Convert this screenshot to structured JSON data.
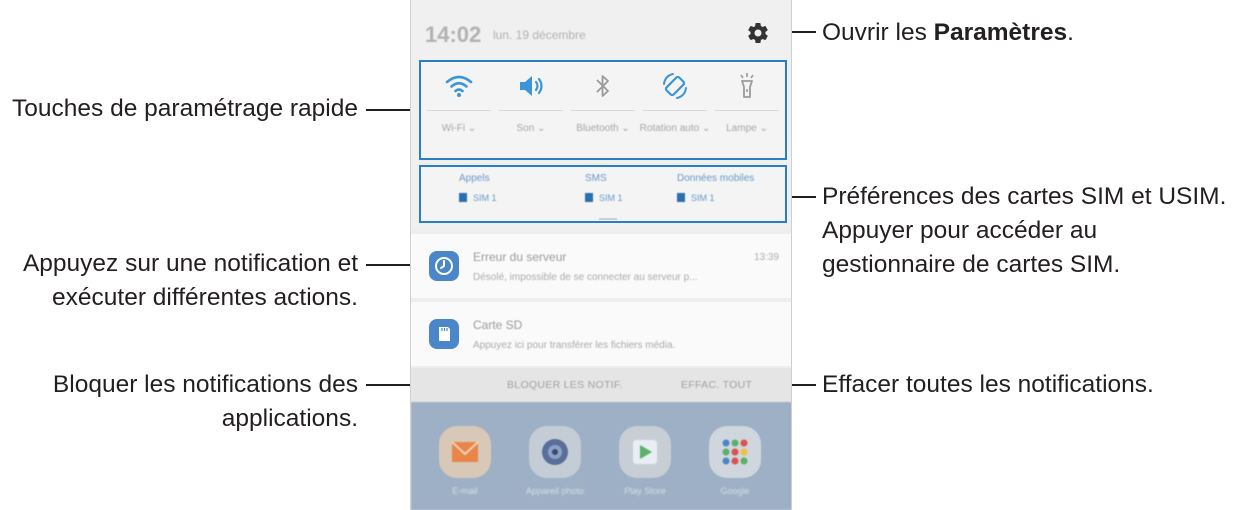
{
  "annotations": {
    "settings_pre": "Ouvrir les ",
    "settings_bold": "Paramètres",
    "settings_post": ".",
    "quick_settings": "Touches de paramétrage rapide",
    "sim_line1": "Préférences des cartes SIM et USIM.",
    "sim_line2": "Appuyer pour accéder au",
    "sim_line3": "gestionnaire de cartes SIM.",
    "notif_line1": "Appuyez sur une notification et",
    "notif_line2": "exécuter différentes actions.",
    "block_line1": "Bloquer les notifications des",
    "block_line2": "applications.",
    "clear_all": "Effacer toutes les notifications."
  },
  "status_bar": {
    "time": "14:02",
    "date": "lun. 19 décembre",
    "icon": "gear-icon"
  },
  "quick_settings": [
    {
      "icon": "wifi-icon",
      "label": "Wi-Fi ⌄",
      "active": true
    },
    {
      "icon": "speaker-icon",
      "label": "Son ⌄",
      "active": true
    },
    {
      "icon": "bluetooth-icon",
      "label": "Bluetooth ⌄",
      "active": false
    },
    {
      "icon": "auto-rotate-icon",
      "label": "Rotation auto ⌄",
      "active": true
    },
    {
      "icon": "flashlight-icon",
      "label": "Lampe ⌄",
      "active": false
    }
  ],
  "sim_preferences": [
    {
      "title": "Appels",
      "value": "SIM 1"
    },
    {
      "title": "SMS",
      "value": "SIM 1"
    },
    {
      "title": "Données mobiles",
      "value": "SIM 1"
    }
  ],
  "notifications": [
    {
      "icon": "clock-icon",
      "title": "Erreur du serveur",
      "text": "Désolé, impossible de se connecter au serveur p...",
      "time": "13:39"
    },
    {
      "icon": "sd-card-icon",
      "title": "Carte SD",
      "text": "Appuyez ici pour transférer les fichiers média.",
      "time": ""
    }
  ],
  "actions": {
    "block": "BLOQUER LES NOTIF.",
    "clear": "EFFAC. TOUT"
  },
  "home_apps": [
    {
      "icon": "email-icon",
      "label": "E-mail"
    },
    {
      "icon": "camera-icon",
      "label": "Appareil photo"
    },
    {
      "icon": "play-store-icon",
      "label": "Play Store"
    },
    {
      "icon": "google-folder-icon",
      "label": "Google"
    }
  ],
  "colors": {
    "accent": "#2a7fc4",
    "icon_blue": "#3d94d6",
    "text": "#231f20"
  }
}
